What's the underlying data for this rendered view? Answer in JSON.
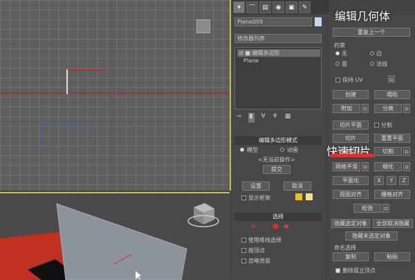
{
  "overlay": {
    "title": "编辑几何体",
    "cut_annotation": "快速切片"
  },
  "colors": {
    "viewport_border": "#d0c050",
    "annotation_red": "#e03030",
    "grid": "#707070",
    "floor_red": "#c03020"
  },
  "command_panel": {
    "tabs": [
      "create-tab",
      "modify-tab",
      "hierarchy-tab",
      "motion-tab",
      "display-tab",
      "utilities-tab"
    ],
    "object_name": "Plane009",
    "modifier_list": "修改器列表",
    "stack": [
      "编辑多边形",
      "Plane"
    ]
  },
  "edit_poly_mode": {
    "header": "编辑多边形模式",
    "model": "模型",
    "animate": "动画",
    "no_op": "<无当前操作>",
    "commit": "提交",
    "settings": "设置",
    "cancel": "取消",
    "show_cage": "显示框架"
  },
  "selection": {
    "header": "选择",
    "use_stack": "使用堆栈选择",
    "by_vertex": "按顶点",
    "ignore_backfacing": "忽略背面"
  },
  "edit_geometry": {
    "repeat_last": "重复上一个",
    "constraints": "约束",
    "none": "无",
    "edge": "边",
    "face": "面",
    "normal": "法线",
    "preserve_uv": "保持 UV",
    "create": "创建",
    "collapse": "塌陷",
    "attach": "附加",
    "detach": "分离",
    "slice_plane": "切片平面",
    "split": "分割",
    "slice": "切片",
    "reset_plane": "重置平面",
    "quickslice": "快速切片",
    "cut": "切割",
    "meshsmooth": "网格平滑",
    "tessellate": "细化",
    "make_planar": "平面化",
    "x": "X",
    "y": "Y",
    "z": "Z",
    "view_align": "视图对齐",
    "grid_align": "栅格对齐",
    "relax": "松弛",
    "hide_selected": "隐藏选定对象",
    "unhide_all": "全部取消隐藏",
    "hide_unselected": "隐藏未选定对象",
    "named_selections": "命名选择",
    "copy": "复制",
    "paste": "粘贴",
    "delete_isolated": "删除孤立顶点"
  }
}
